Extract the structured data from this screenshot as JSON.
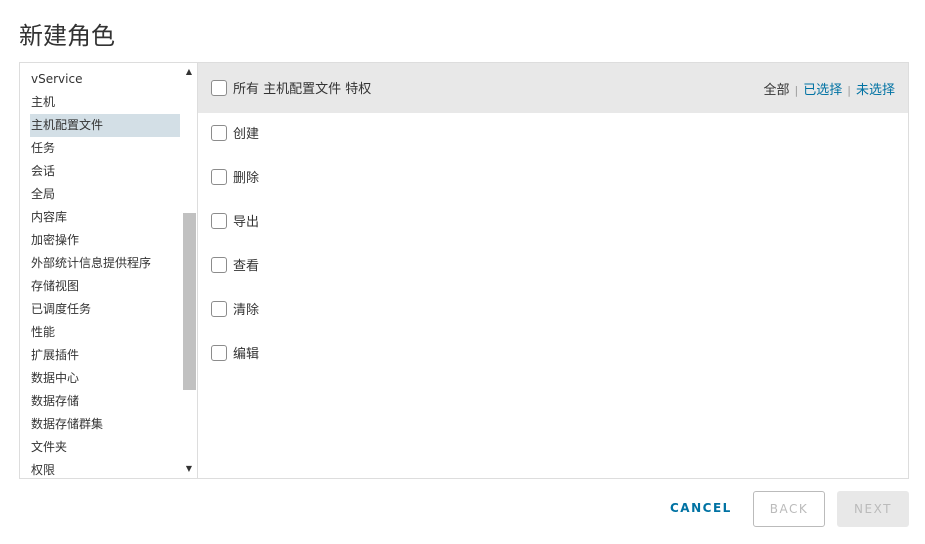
{
  "title": "新建角色",
  "sidebar": {
    "items": [
      "vService",
      "主机",
      "主机配置文件",
      "任务",
      "会话",
      "全局",
      "内容库",
      "加密操作",
      "外部统计信息提供程序",
      "存储视图",
      "已调度任务",
      "性能",
      "扩展插件",
      "数据中心",
      "数据存储",
      "数据存储群集",
      "文件夹",
      "权限"
    ],
    "selected_index": 2
  },
  "header": {
    "all_label": "所有 主机配置文件 特权",
    "filters": [
      "全部",
      "已选择",
      "未选择"
    ],
    "active_filter": "全部"
  },
  "privileges": [
    "创建",
    "删除",
    "导出",
    "查看",
    "清除",
    "编辑"
  ],
  "footer": {
    "cancel": "CANCEL",
    "back": "BACK",
    "next": "NEXT"
  },
  "colors": {
    "accent": "#0072a3",
    "selected_bg": "#d3dfe6",
    "header_bg": "#e8e8e8"
  }
}
